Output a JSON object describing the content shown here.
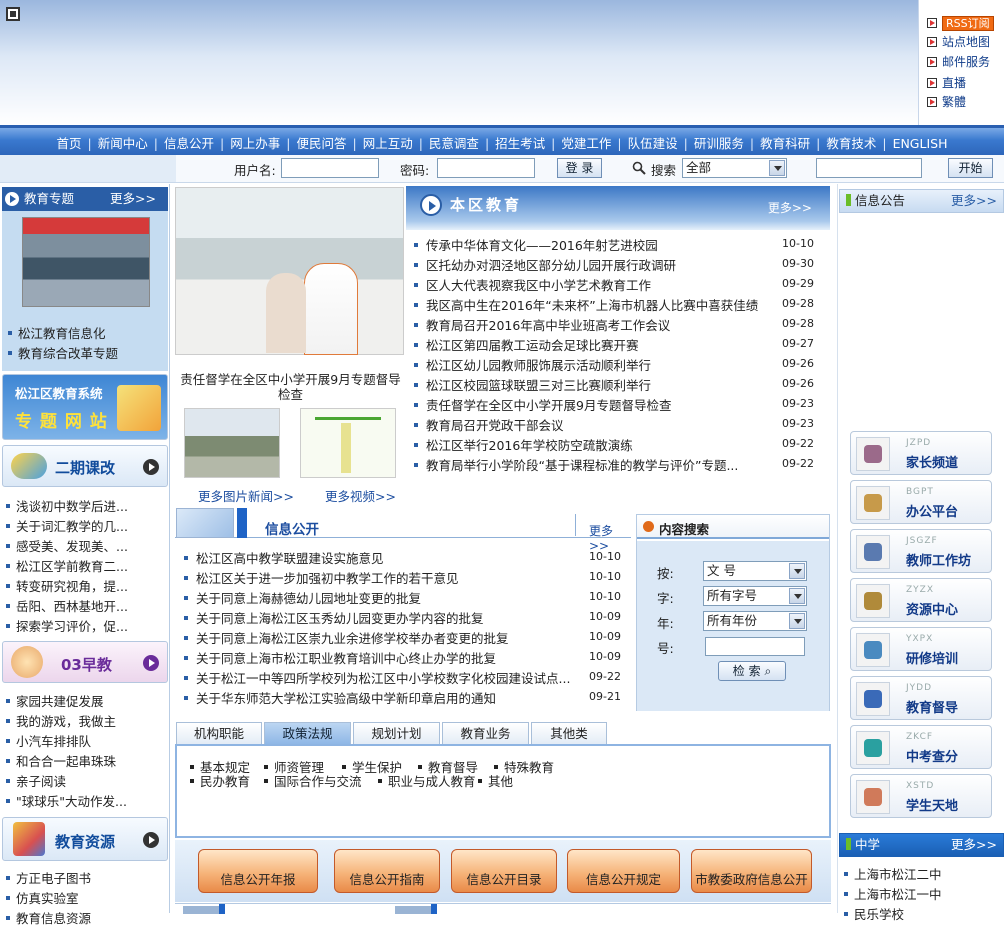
{
  "quick_links": {
    "rss": "RSS订阅",
    "items": [
      "站点地图",
      "邮件服务",
      "直播",
      "繁體"
    ]
  },
  "nav": [
    "首页",
    "新闻中心",
    "信息公开",
    "网上办事",
    "便民问答",
    "网上互动",
    "民意调查",
    "招生考试",
    "党建工作",
    "队伍建设",
    "研训服务",
    "教育科研",
    "教育技术",
    "ENGLISH"
  ],
  "login": {
    "user_label": "用户名:",
    "pass_label": "密码:",
    "login_btn": "登 录",
    "search_label": "搜索",
    "search_scope": "全部",
    "start_btn": "开始"
  },
  "left": {
    "topic": {
      "title": "教育专题",
      "more": "更多>>",
      "items": [
        "松江教育信息化",
        "教育综合改革专题"
      ]
    },
    "system_banner": {
      "line1": "松江区教育系统",
      "line2": "专 题 网 站"
    },
    "er": {
      "title": "二期课改",
      "items": [
        "浅谈初中数学后进...",
        "关于词汇教学的几...",
        "感受美、发现美、...",
        "松江区学前教育二...",
        "转变研究视角，提...",
        "岳阳、西林基地开...",
        "探索学习评价，促..."
      ]
    },
    "zao": {
      "title": "03早教",
      "items": [
        "家园共建促发展",
        "我的游戏，我做主",
        "小汽车排排队",
        "和合合一起串珠珠",
        "亲子阅读",
        "\"球球乐\"大动作发..."
      ]
    },
    "res": {
      "title": "教育资源",
      "items": [
        "方正电子图书",
        "仿真实验室",
        "教育信息资源"
      ]
    }
  },
  "photo": {
    "caption": "责任督学在全区中小学开展9月专题督导检查",
    "more_photo": "更多图片新闻>>",
    "more_video": "更多视频>>"
  },
  "news": {
    "title": "本区教育",
    "more": "更多>>",
    "items": [
      {
        "t": "传承中华体育文化——2016年射艺进校园",
        "d": "10-10"
      },
      {
        "t": "区托幼办对泗泾地区部分幼儿园开展行政调研",
        "d": "09-30"
      },
      {
        "t": "区人大代表视察我区中小学艺术教育工作",
        "d": "09-29"
      },
      {
        "t": "我区高中生在2016年“未来杯”上海市机器人比赛中喜获佳绩",
        "d": "09-28"
      },
      {
        "t": "教育局召开2016年高中毕业班高考工作会议",
        "d": "09-28"
      },
      {
        "t": "松江区第四届教工运动会足球比赛开赛",
        "d": "09-27"
      },
      {
        "t": "松江区幼儿园教师服饰展示活动顺利举行",
        "d": "09-26"
      },
      {
        "t": "松江区校园篮球联盟三对三比赛顺利举行",
        "d": "09-26"
      },
      {
        "t": "责任督学在全区中小学开展9月专题督导检查",
        "d": "09-23"
      },
      {
        "t": "教育局召开党政干部会议",
        "d": "09-23"
      },
      {
        "t": "松江区举行2016年学校防空疏散演练",
        "d": "09-22"
      },
      {
        "t": "教育局举行小学阶段“基于课程标准的教学与评价”专题...",
        "d": "09-22"
      }
    ]
  },
  "info": {
    "title": "信息公开",
    "more": "更多>>",
    "items": [
      {
        "t": "松江区高中教学联盟建设实施意见",
        "d": "10-10"
      },
      {
        "t": "松江区关于进一步加强初中教学工作的若干意见",
        "d": "10-10"
      },
      {
        "t": "关于同意上海赫德幼儿园地址变更的批复",
        "d": "10-10"
      },
      {
        "t": "关于同意上海松江区玉秀幼儿园变更办学内容的批复",
        "d": "10-09"
      },
      {
        "t": "关于同意上海松江区崇九业余进修学校举办者变更的批复",
        "d": "10-09"
      },
      {
        "t": "关于同意上海市松江职业教育培训中心终止办学的批复",
        "d": "10-09"
      },
      {
        "t": "关于松江一中等四所学校列为松江区中小学校数字化校园建设试点...",
        "d": "09-22"
      },
      {
        "t": "关于华东师范大学松江实验高级中学新印章启用的通知",
        "d": "09-21"
      }
    ]
  },
  "content_search": {
    "title": "内容搜索",
    "labels": [
      "按:",
      "字:",
      "年:",
      "号:"
    ],
    "values": [
      "文 号",
      "所有字号",
      "所有年份"
    ],
    "btn": "检 索"
  },
  "tabs": [
    "机构职能",
    "政策法规",
    "规划计划",
    "教育业务",
    "其他类"
  ],
  "tab_items_row1": [
    "基本规定",
    "师资管理",
    "学生保护",
    "教育督导",
    "特殊教育"
  ],
  "tab_items_row2": [
    "民办教育",
    "国际合作与交流",
    "职业与成人教育",
    "其他"
  ],
  "pills": [
    "信息公开年报",
    "信息公开指南",
    "信息公开目录",
    "信息公开规定",
    "市教委政府信息公开"
  ],
  "right": {
    "notice": {
      "title": "信息公告",
      "more": "更多>>"
    },
    "channels": [
      {
        "en": "JZPD",
        "cn": "家长频道"
      },
      {
        "en": "BGPT",
        "cn": "办公平台"
      },
      {
        "en": "JSGZF",
        "cn": "教师工作坊"
      },
      {
        "en": "ZYZX",
        "cn": "资源中心"
      },
      {
        "en": "YXPX",
        "cn": "研修培训"
      },
      {
        "en": "JYDD",
        "cn": "教育督导"
      },
      {
        "en": "ZKCF",
        "cn": "中考查分"
      },
      {
        "en": "XSTD",
        "cn": "学生天地"
      }
    ],
    "school": {
      "title": "中学",
      "more": "更多>>",
      "items": [
        "上海市松江二中",
        "上海市松江一中",
        "民乐学校"
      ]
    }
  }
}
